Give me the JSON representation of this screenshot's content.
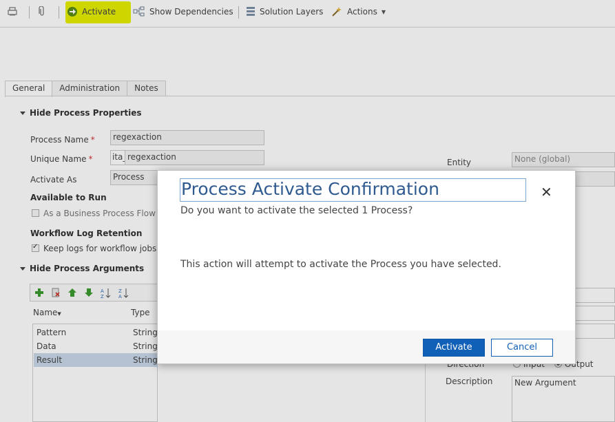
{
  "toolbar": {
    "activate_label": "Activate",
    "show_dependencies_label": "Show Dependencies",
    "solution_layers_label": "Solution Layers",
    "actions_label": "Actions",
    "highlight_color": "#e6ef00"
  },
  "tabs": [
    "General",
    "Administration",
    "Notes"
  ],
  "process_properties": {
    "section_label": "Hide Process Properties",
    "process_name_label": "Process Name",
    "process_name_value": "regexaction",
    "unique_name_label": "Unique Name",
    "unique_name_prefix": "ita_",
    "unique_name_value": "regexaction",
    "activate_as_label": "Activate As",
    "activate_as_value": "Process",
    "available_to_run_label": "Available to Run",
    "bpf_checkbox_label": "As a Business Process Flow ac",
    "workflow_log_label": "Workflow Log Retention",
    "keep_logs_label": "Keep logs for workflow jobs th",
    "required_mark": "*"
  },
  "process_arguments": {
    "section_label": "Hide Process Arguments",
    "columns": [
      "Name",
      "Type"
    ],
    "rows": [
      {
        "name": "Pattern",
        "type": "String"
      },
      {
        "name": "Data",
        "type": "String"
      },
      {
        "name": "Result",
        "type": "String"
      }
    ]
  },
  "right_panel": {
    "entity_label": "Entity",
    "entity_value": "None (global)",
    "direction_label": "Direction",
    "direction_input": "Input",
    "direction_output": "Output",
    "description_label": "Description",
    "description_value": "New Argument"
  },
  "dialog": {
    "title": "Process Activate Confirmation",
    "subtitle": "Do you want to activate the selected 1 Process?",
    "body": "This action will attempt to activate the Process you have selected.",
    "activate_button": "Activate",
    "cancel_button": "Cancel",
    "close_glyph": "✕",
    "primary_color": "#1160b7"
  }
}
